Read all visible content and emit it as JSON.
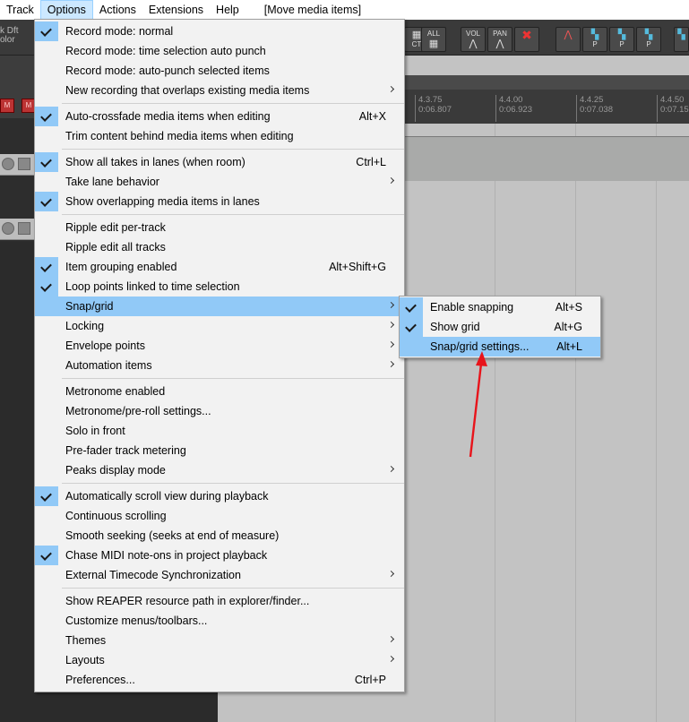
{
  "menubar": {
    "items": [
      "Track",
      "Options",
      "Actions",
      "Extensions",
      "Help"
    ],
    "status": "[Move media items]"
  },
  "toolbar": {
    "color_label_line1": "k Dft",
    "color_label_line2": "olor",
    "buttons": [
      {
        "label": "CT",
        "icon": "ct-icon"
      },
      {
        "label": "ALL",
        "icon": "all-icon"
      },
      {
        "label": "VOL",
        "icon": "volume-envelope-icon"
      },
      {
        "label": "PAN",
        "icon": "pan-envelope-icon"
      },
      {
        "label": "",
        "icon": "delete-x-icon"
      },
      {
        "label": "",
        "icon": "envelope-point-icon"
      },
      {
        "label": "P",
        "icon": "envelope-p-icon"
      },
      {
        "label": "P",
        "icon": "envelope-p-icon"
      },
      {
        "label": "P",
        "icon": "envelope-p-icon"
      },
      {
        "label": "P",
        "icon": "envelope-p-icon"
      }
    ],
    "rec_label": "M"
  },
  "ruler": {
    "marks": [
      {
        "bar": "4.3.75",
        "time": "0:06.807"
      },
      {
        "bar": "4.4.00",
        "time": "0:06.923"
      },
      {
        "bar": "4.4.25",
        "time": "0:07.038"
      },
      {
        "bar": "4.4.50",
        "time": "0:07.15"
      }
    ]
  },
  "options_menu": {
    "groups": [
      [
        {
          "label": "Record mode: normal",
          "checked": true,
          "shortcut": "",
          "submenu": false
        },
        {
          "label": "Record mode: time selection auto punch",
          "checked": false,
          "shortcut": "",
          "submenu": false
        },
        {
          "label": "Record mode: auto-punch selected items",
          "checked": false,
          "shortcut": "",
          "submenu": false
        },
        {
          "label": "New recording that overlaps existing media items",
          "checked": false,
          "shortcut": "",
          "submenu": true
        }
      ],
      [
        {
          "label": "Auto-crossfade media items when editing",
          "checked": true,
          "shortcut": "Alt+X",
          "submenu": false
        },
        {
          "label": "Trim content behind media items when editing",
          "checked": false,
          "shortcut": "",
          "submenu": false
        }
      ],
      [
        {
          "label": "Show all takes in lanes (when room)",
          "checked": true,
          "shortcut": "Ctrl+L",
          "submenu": false
        },
        {
          "label": "Take lane behavior",
          "checked": false,
          "shortcut": "",
          "submenu": true
        },
        {
          "label": "Show overlapping media items in lanes",
          "checked": true,
          "shortcut": "",
          "submenu": false
        }
      ],
      [
        {
          "label": "Ripple edit per-track",
          "checked": false,
          "shortcut": "",
          "submenu": false
        },
        {
          "label": "Ripple edit all tracks",
          "checked": false,
          "shortcut": "",
          "submenu": false
        },
        {
          "label": "Item grouping enabled",
          "checked": true,
          "shortcut": "Alt+Shift+G",
          "submenu": false
        },
        {
          "label": "Loop points linked to time selection",
          "checked": true,
          "shortcut": "",
          "submenu": false
        },
        {
          "label": "Snap/grid",
          "checked": false,
          "shortcut": "",
          "submenu": true,
          "highlighted": true
        },
        {
          "label": "Locking",
          "checked": false,
          "shortcut": "",
          "submenu": true
        },
        {
          "label": "Envelope points",
          "checked": false,
          "shortcut": "",
          "submenu": true
        },
        {
          "label": "Automation items",
          "checked": false,
          "shortcut": "",
          "submenu": true
        }
      ],
      [
        {
          "label": "Metronome enabled",
          "checked": false,
          "shortcut": "",
          "submenu": false
        },
        {
          "label": "Metronome/pre-roll settings...",
          "checked": false,
          "shortcut": "",
          "submenu": false
        },
        {
          "label": "Solo in front",
          "checked": false,
          "shortcut": "",
          "submenu": false
        },
        {
          "label": "Pre-fader track metering",
          "checked": false,
          "shortcut": "",
          "submenu": false
        },
        {
          "label": "Peaks display mode",
          "checked": false,
          "shortcut": "",
          "submenu": true
        }
      ],
      [
        {
          "label": "Automatically scroll view during playback",
          "checked": true,
          "shortcut": "",
          "submenu": false
        },
        {
          "label": "Continuous scrolling",
          "checked": false,
          "shortcut": "",
          "submenu": false
        },
        {
          "label": "Smooth seeking (seeks at end of measure)",
          "checked": false,
          "shortcut": "",
          "submenu": false
        },
        {
          "label": "Chase MIDI note-ons in project playback",
          "checked": true,
          "shortcut": "",
          "submenu": false
        },
        {
          "label": "External Timecode Synchronization",
          "checked": false,
          "shortcut": "",
          "submenu": true
        }
      ],
      [
        {
          "label": "Show REAPER resource path in explorer/finder...",
          "checked": false,
          "shortcut": "",
          "submenu": false
        },
        {
          "label": "Customize menus/toolbars...",
          "checked": false,
          "shortcut": "",
          "submenu": false
        },
        {
          "label": "Themes",
          "checked": false,
          "shortcut": "",
          "submenu": true
        },
        {
          "label": "Layouts",
          "checked": false,
          "shortcut": "",
          "submenu": true
        },
        {
          "label": "Preferences...",
          "checked": false,
          "shortcut": "Ctrl+P",
          "submenu": false
        }
      ]
    ]
  },
  "snap_menu": {
    "items": [
      {
        "label": "Enable snapping",
        "checked": true,
        "shortcut": "Alt+S",
        "highlighted": false
      },
      {
        "label": "Show grid",
        "checked": true,
        "shortcut": "Alt+G",
        "highlighted": false
      },
      {
        "label": "Snap/grid settings...",
        "checked": false,
        "shortcut": "Alt+L",
        "highlighted": true
      }
    ]
  },
  "colors": {
    "highlight": "#91c9f7",
    "menu_bg": "#f2f2f2",
    "annotation_arrow": "#e8141b"
  }
}
